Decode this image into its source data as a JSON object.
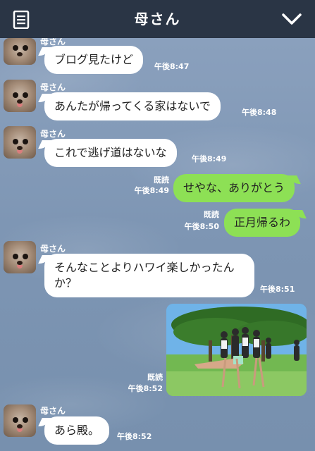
{
  "header": {
    "title": "母さん",
    "menu_icon": "list-icon",
    "collapse_icon": "chevron-down-icon"
  },
  "colors": {
    "header_bg": "#2a3545",
    "chat_bg": "#7f97b5",
    "bubble_in": "#ffffff",
    "bubble_out": "#8de055"
  },
  "messages": [
    {
      "sender": "母さん",
      "text": "ブログ見たけど",
      "time": "午後8:47"
    },
    {
      "sender": "母さん",
      "text": "あんたが帰ってくる家はないで",
      "time": "午後8:48"
    },
    {
      "sender": "母さん",
      "text": "これで逃げ道はないな",
      "time": "午後8:49"
    },
    {
      "read": "既読",
      "text": "せやな、ありがとう",
      "time": "午後8:49"
    },
    {
      "read": "既読",
      "text": "正月帰るわ",
      "time": "午後8:50"
    },
    {
      "sender": "母さん",
      "text": "そんなことよりハワイ楽しかったんか？",
      "time": "午後8:51"
    },
    {
      "read": "既読",
      "photo": "group-photo",
      "time": "午後8:52"
    },
    {
      "sender": "母さん",
      "text": "あら殿。",
      "time": "午後8:52"
    }
  ]
}
